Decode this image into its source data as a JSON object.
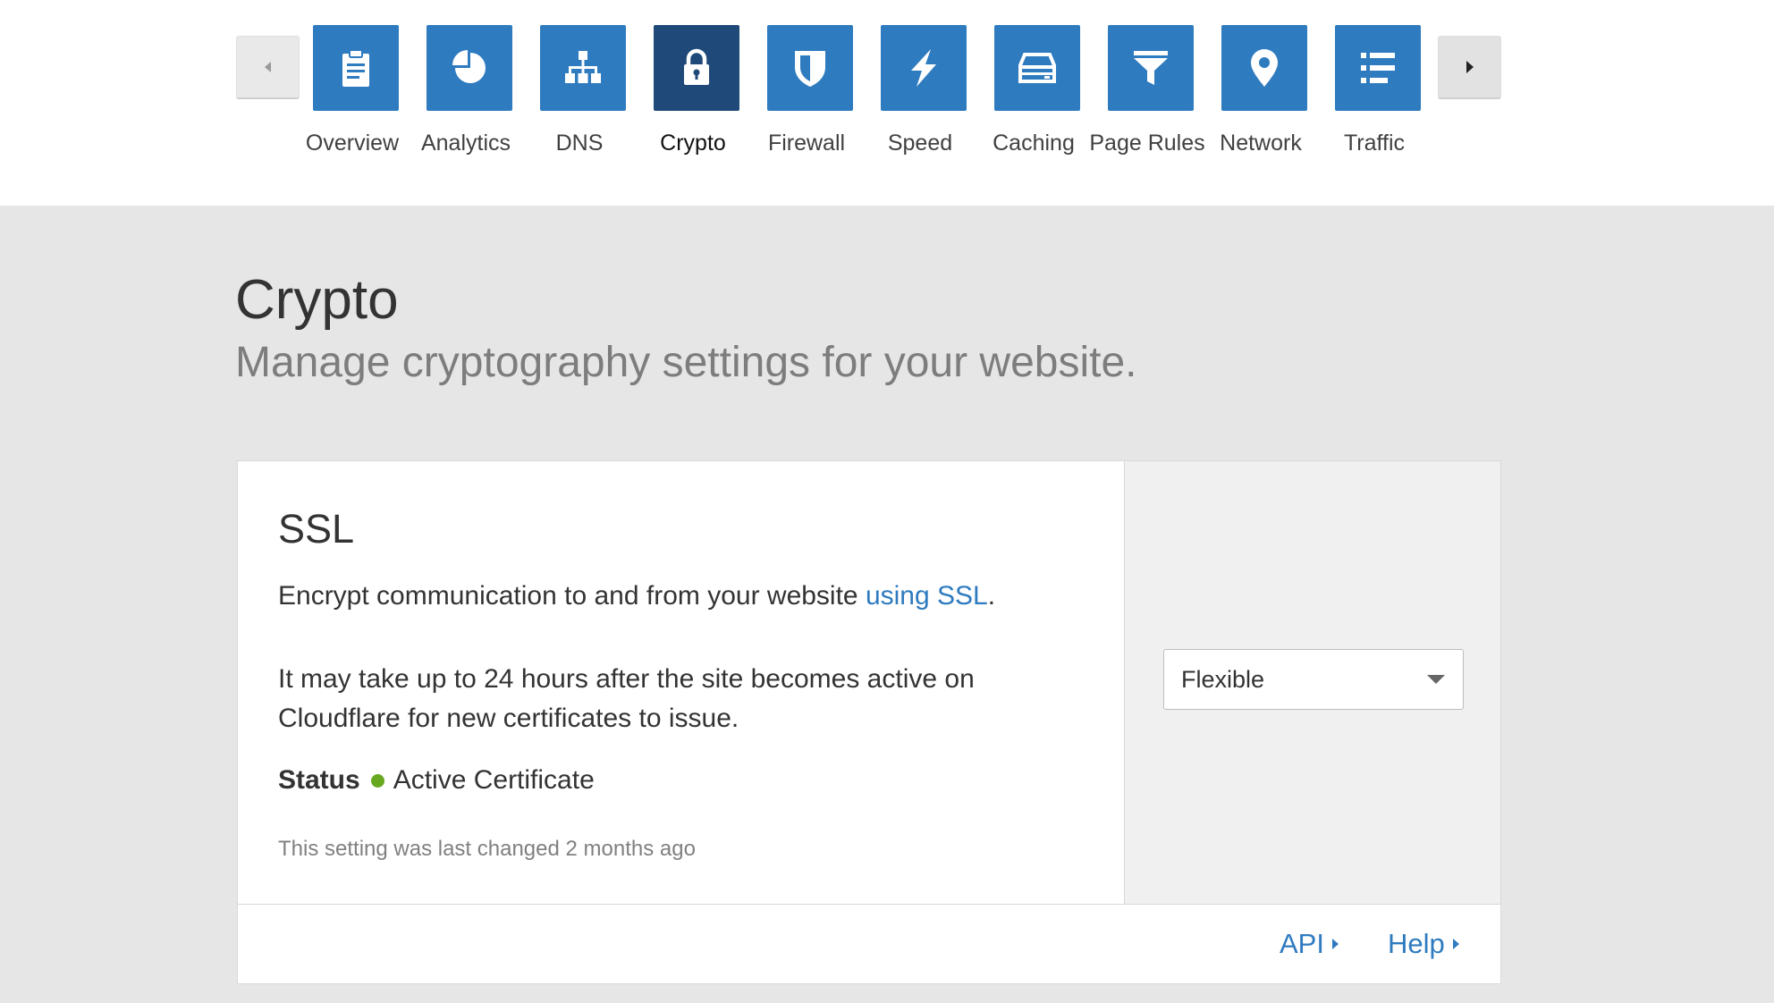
{
  "nav": {
    "items": [
      {
        "label": "Overview",
        "icon": "clipboard-icon"
      },
      {
        "label": "Analytics",
        "icon": "pie-chart-icon"
      },
      {
        "label": "DNS",
        "icon": "network-tree-icon"
      },
      {
        "label": "Crypto",
        "icon": "lock-icon",
        "active": true
      },
      {
        "label": "Firewall",
        "icon": "shield-icon"
      },
      {
        "label": "Speed",
        "icon": "lightning-icon"
      },
      {
        "label": "Caching",
        "icon": "server-drive-icon"
      },
      {
        "label": "Page Rules",
        "icon": "funnel-icon"
      },
      {
        "label": "Network",
        "icon": "location-pin-icon"
      },
      {
        "label": "Traffic",
        "icon": "list-icon"
      }
    ]
  },
  "page": {
    "title": "Crypto",
    "subtitle": "Manage cryptography settings for your website."
  },
  "ssl_card": {
    "title": "SSL",
    "description_prefix": "Encrypt communication to and from your website ",
    "description_link": "using SSL",
    "description_suffix": ".",
    "note": "It may take up to 24 hours after the site becomes active on Cloudflare for new certificates to issue.",
    "status_label": "Status",
    "status_value": "Active Certificate",
    "status_color": "#68a820",
    "last_changed": "This setting was last changed 2 months ago",
    "ssl_mode": "Flexible",
    "footer_api": "API",
    "footer_help": "Help"
  },
  "colors": {
    "accent": "#2f7bbf",
    "active_tile": "#1e4978",
    "background": "#e6e6e6"
  }
}
